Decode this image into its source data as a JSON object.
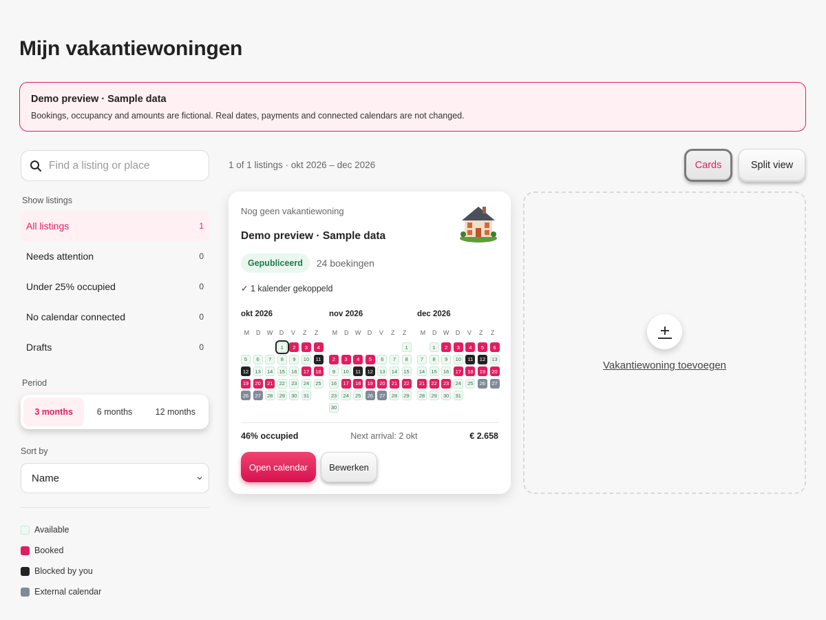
{
  "page": {
    "title": "Mijn vakantiewoningen"
  },
  "banner": {
    "title": "Demo preview · Sample data",
    "text": "Bookings, occupancy and amounts are fictional. Real dates, payments and connected calendars are not changed."
  },
  "search": {
    "placeholder": "Find a listing or place",
    "value": ""
  },
  "sidebar": {
    "show_label": "Show listings",
    "filters": [
      {
        "label": "All listings",
        "count": "1",
        "active": true
      },
      {
        "label": "Needs attention",
        "count": "0"
      },
      {
        "label": "Under 25% occupied",
        "count": "0"
      },
      {
        "label": "No calendar connected",
        "count": "0"
      },
      {
        "label": "Drafts",
        "count": "0"
      }
    ],
    "period_label": "Period",
    "periods": [
      "3 months",
      "6 months",
      "12 months"
    ],
    "period_selected": "3 months",
    "sort_label": "Sort by",
    "sort_value": "Name",
    "legend": [
      {
        "label": "Available",
        "color": "#edf9f1"
      },
      {
        "label": "Booked",
        "color": "#e31c5f"
      },
      {
        "label": "Blocked by you",
        "color": "#222222"
      },
      {
        "label": "External calendar",
        "color": "#7f8a99"
      }
    ]
  },
  "results": {
    "info": "1 of 1 listings · okt 2026 – dec 2026"
  },
  "views": {
    "cards": "Cards",
    "split": "Split view",
    "selected": "Cards"
  },
  "listing": {
    "subtitle": "Nog geen vakantiewoning",
    "name": "Demo preview · Sample data",
    "status": "Gepubliceerd",
    "bookings": "24 boekingen",
    "calendar_info": "✓ 1 kalender gekoppeld",
    "weekdays": [
      "M",
      "D",
      "W",
      "D",
      "V",
      "Z",
      "Z"
    ],
    "months": [
      {
        "label": "okt 2026",
        "offset": 3,
        "days": 31,
        "today": 1,
        "booked": [
          2,
          3,
          4,
          17,
          18,
          19,
          20,
          21
        ],
        "blocked": [
          11,
          12
        ],
        "external": [
          26,
          27
        ]
      },
      {
        "label": "nov 2026",
        "offset": 6,
        "days": 30,
        "today": null,
        "booked": [
          2,
          3,
          4,
          5,
          17,
          18,
          19,
          20,
          21,
          22
        ],
        "blocked": [
          11,
          12
        ],
        "external": [
          26,
          27
        ]
      },
      {
        "label": "dec 2026",
        "offset": 1,
        "days": 31,
        "today": null,
        "booked": [
          2,
          3,
          4,
          5,
          6,
          17,
          18,
          19,
          20,
          21,
          22,
          23
        ],
        "blocked": [
          11,
          12
        ],
        "external": [
          26,
          27
        ]
      }
    ],
    "occupancy": "46% occupied",
    "next_arrival": "Next arrival: 2 okt",
    "amount": "€ 2.658",
    "open_calendar": "Open calendar",
    "edit": "Bewerken"
  },
  "add_tile": {
    "label": "Vakantiewoning toevoegen"
  },
  "colors": {
    "accent": "#e31c5f",
    "booked": "#e31c5f",
    "blocked": "#222222",
    "external": "#7f8a99",
    "published": "#1d7a47"
  }
}
